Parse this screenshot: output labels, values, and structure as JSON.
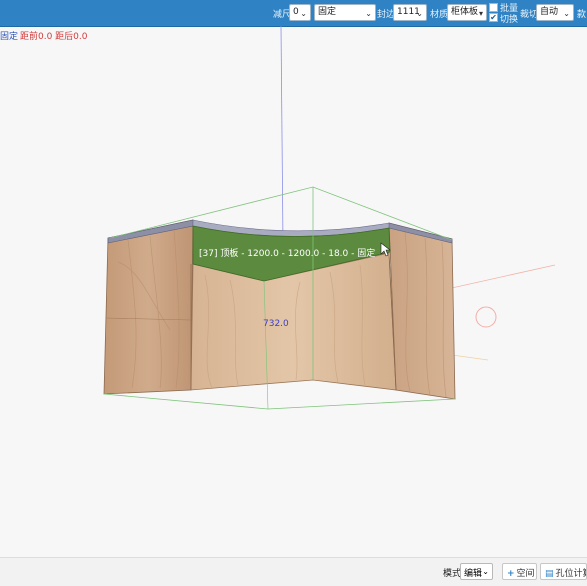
{
  "toolbar": {
    "reduce_label": "减尺",
    "reduce_value": "0",
    "mode_value": "固定",
    "edge_label": "封边",
    "edge_value": "1111",
    "material_label": "材质",
    "material_value": "柜体板",
    "batch_label": "批量",
    "switch_label": "切换",
    "switch_checked": true,
    "cut_label": "裁切",
    "cut_value": "自动",
    "tail_label": "款"
  },
  "status": {
    "fixed": "固定",
    "distance": "距前0.0 距后0.0"
  },
  "viewport": {
    "panel_label": "[37] 顶板 - 1200.0 - 1200.0 - 18.0 - 固定",
    "dimension_value": "732.0"
  },
  "bottom": {
    "mode_label": "模式",
    "mode_value": "编辑",
    "space_button": "空间",
    "hole_button": "孔位计算"
  },
  "colors": {
    "toolbar_bg": "#2f83c5",
    "selected_panel": "#5c8b3f",
    "status_blue": "#2b53b8",
    "status_red": "#d23a3a",
    "dimension_blue": "#3f3fbf"
  }
}
